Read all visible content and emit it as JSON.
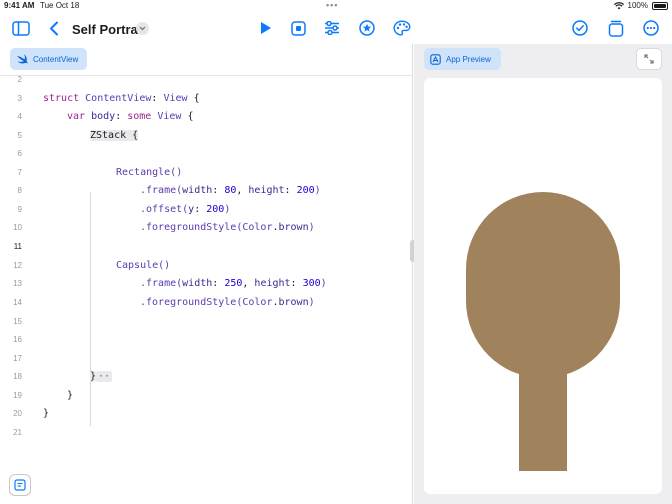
{
  "status": {
    "time": "9:41 AM",
    "date": "Tue Oct 18",
    "battery": "100%"
  },
  "toolbar": {
    "title": "Self Portrait"
  },
  "editor": {
    "tab_label": "ContentView",
    "line_numbers": [
      "2",
      "3",
      "4",
      "5",
      "6",
      "7",
      "8",
      "9",
      "10",
      "11",
      "12",
      "13",
      "14",
      "15",
      "16",
      "17",
      "18",
      "19",
      "20",
      "21"
    ],
    "code": {
      "l3_a": "struct",
      "l3_b": "ContentView",
      "l3_c": ":",
      "l3_d": "View",
      "l3_e": "{",
      "l4_a": "var",
      "l4_b": "body",
      "l4_c": ":",
      "l4_d": "some",
      "l4_e": "View",
      "l4_f": "{",
      "l5": "ZStack {",
      "l7": "Rectangle()",
      "l8_a": ".frame(",
      "l8_b": "width",
      "l8_c": ": ",
      "l8_d": "80",
      "l8_e": ", ",
      "l8_f": "height",
      "l8_g": ": ",
      "l8_h": "200",
      "l8_i": ")",
      "l9_a": ".offset(",
      "l9_b": "y",
      "l9_c": ": ",
      "l9_d": "200",
      "l9_e": ")",
      "l10_a": ".foregroundStyle(",
      "l10_b": "Color",
      "l10_c": ".",
      "l10_d": "brown",
      "l10_e": ")",
      "l12": "Capsule()",
      "l13_a": ".frame(",
      "l13_b": "width",
      "l13_c": ": ",
      "l13_d": "250",
      "l13_e": ", ",
      "l13_f": "height",
      "l13_g": ": ",
      "l13_h": "300",
      "l13_i": ")",
      "l14_a": ".foregroundStyle(",
      "l14_b": "Color",
      "l14_c": ".",
      "l14_d": "brown",
      "l14_e": ")",
      "l18_a": "}",
      "l18_b": "··",
      "l19": "}",
      "l20": "}"
    }
  },
  "preview": {
    "tab_label": "App Preview",
    "shape_color": "#a0825c"
  },
  "colors": {
    "accent": "#0a7aff",
    "brown": "#a0825c"
  }
}
